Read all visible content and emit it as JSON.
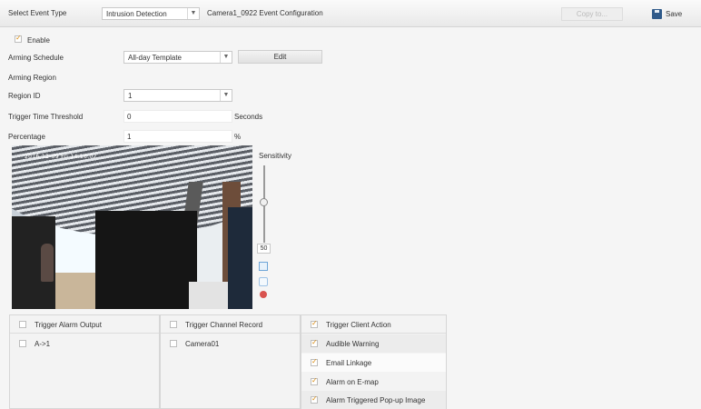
{
  "toolbar": {
    "event_type_label": "Select Event Type",
    "event_type_value": "Intrusion Detection",
    "config_title": "Camera1_0922 Event Configuration",
    "copy_label": "Copy to...",
    "save_label": "Save"
  },
  "form": {
    "enable_label": "Enable",
    "enable_checked": true,
    "schedule_label": "Arming Schedule",
    "schedule_value": "All-day Template",
    "edit_label": "Edit",
    "region_label": "Arming Region",
    "region_id_label": "Region ID",
    "region_id_value": "1",
    "threshold_label": "Trigger Time Threshold",
    "threshold_value": "0",
    "threshold_unit": "Seconds",
    "percentage_label": "Percentage",
    "percentage_value": "1",
    "percentage_unit": "%"
  },
  "preview": {
    "osd_text": "2016-12-09  Fri  14:16:02",
    "sensitivity_label": "Sensitivity",
    "sensitivity_value": "50"
  },
  "actions": {
    "alarm_output": {
      "header": "Trigger Alarm Output",
      "items": [
        "A->1"
      ]
    },
    "channel_record": {
      "header": "Trigger Channel Record",
      "items": [
        "Camera01"
      ]
    },
    "client_action": {
      "header": "Trigger Client Action",
      "items": [
        "Audible Warning",
        "Email Linkage",
        "Alarm on E-map",
        "Alarm Triggered Pop-up Image"
      ]
    }
  },
  "colors": {
    "accent": "#d98c12",
    "panel_bg": "#f3f3f3",
    "save_icon": "#2f5a8a"
  }
}
